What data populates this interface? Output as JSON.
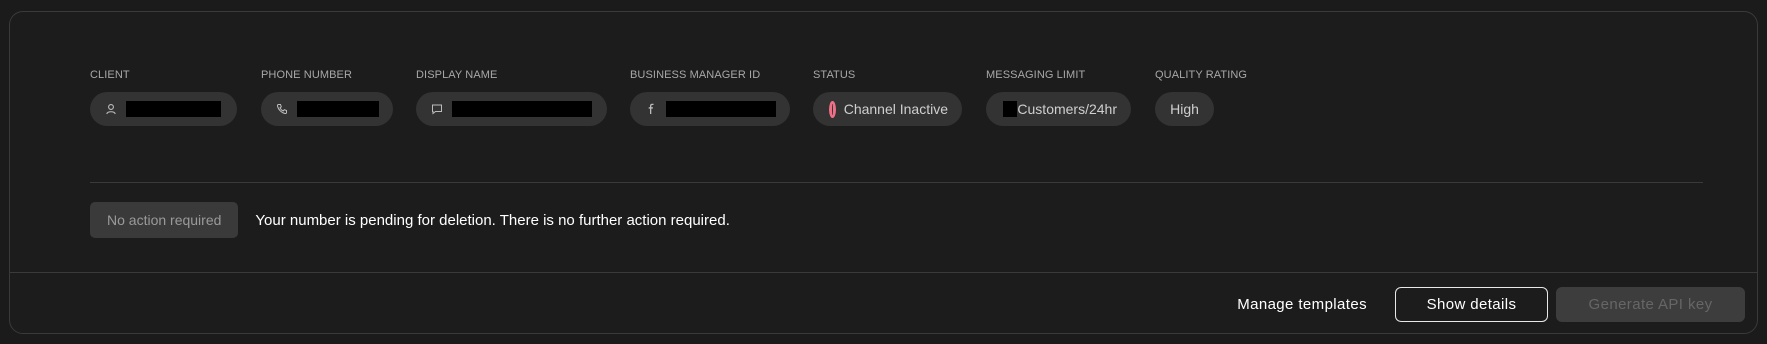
{
  "fields": {
    "client": {
      "label": "CLIENT",
      "value": "",
      "icon": "user-icon"
    },
    "phone": {
      "label": "PHONE NUMBER",
      "value": "",
      "icon": "phone-icon"
    },
    "display_name": {
      "label": "DISPLAY NAME",
      "value": "",
      "icon": "chat-icon"
    },
    "bm_id": {
      "label": "BUSINESS MANAGER ID",
      "value": "",
      "icon": "facebook-icon"
    },
    "status": {
      "label": "STATUS",
      "value": "Channel Inactive",
      "color": "#ef6f86"
    },
    "messaging_limit": {
      "label": "MESSAGING LIMIT",
      "value": "Customers/24hr"
    },
    "quality": {
      "label": "QUALITY RATING",
      "value": "High"
    }
  },
  "notice": {
    "badge": "No action required",
    "text": "Your number is pending for deletion. There is no further action required."
  },
  "footer": {
    "manage_templates": "Manage templates",
    "show_details": "Show details",
    "generate_api_key": "Generate API key"
  }
}
